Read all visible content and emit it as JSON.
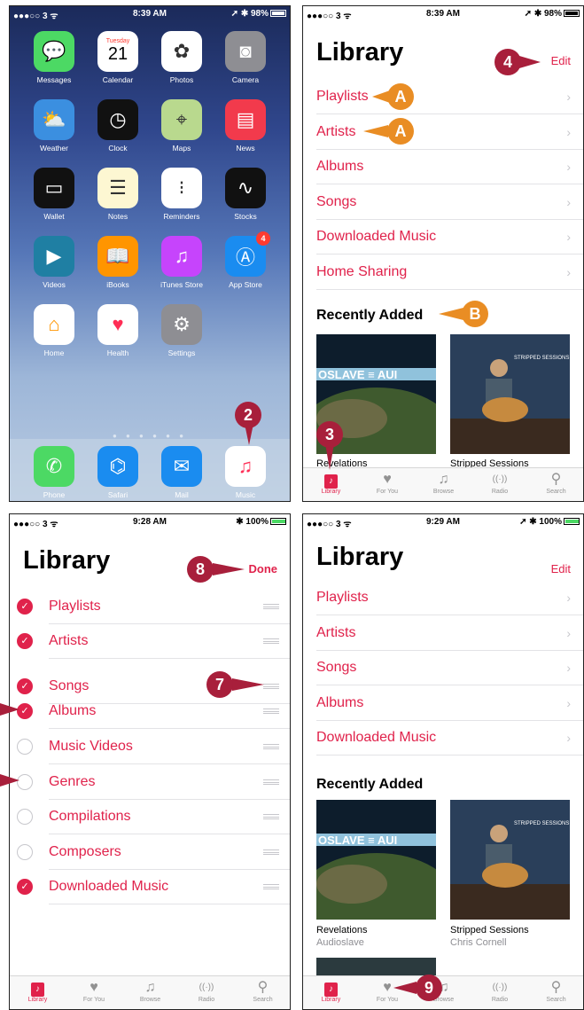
{
  "home": {
    "status": {
      "left": "●●●○○ 3 ᯤ",
      "time": "8:39 AM",
      "right": "➚ ✱ 98%"
    },
    "apps": [
      {
        "label": "Messages",
        "icon": "messages-icon",
        "glyph": "💬",
        "color": "#4cd964"
      },
      {
        "label": "Calendar",
        "icon": "calendar-icon",
        "glyph": "21",
        "color": "#ffffff",
        "sub": "Tuesday"
      },
      {
        "label": "Photos",
        "icon": "photos-icon",
        "glyph": "✿",
        "color": "#ffffff"
      },
      {
        "label": "Camera",
        "icon": "camera-icon",
        "glyph": "◙",
        "color": "#8e8e93"
      },
      {
        "label": "Weather",
        "icon": "weather-icon",
        "glyph": "⛅",
        "color": "#3b8fe0"
      },
      {
        "label": "Clock",
        "icon": "clock-icon",
        "glyph": "◷",
        "color": "#111111"
      },
      {
        "label": "Maps",
        "icon": "maps-icon",
        "glyph": "⌖",
        "color": "#b9d98e"
      },
      {
        "label": "News",
        "icon": "news-icon",
        "glyph": "▤",
        "color": "#f23a4c"
      },
      {
        "label": "Wallet",
        "icon": "wallet-icon",
        "glyph": "▭",
        "color": "#111111"
      },
      {
        "label": "Notes",
        "icon": "notes-icon",
        "glyph": "☰",
        "color": "#fdf7d2"
      },
      {
        "label": "Reminders",
        "icon": "reminders-icon",
        "glyph": "⁝",
        "color": "#ffffff"
      },
      {
        "label": "Stocks",
        "icon": "stocks-icon",
        "glyph": "∿",
        "color": "#111111"
      },
      {
        "label": "Videos",
        "icon": "videos-icon",
        "glyph": "▶",
        "color": "#1f7fa3"
      },
      {
        "label": "iBooks",
        "icon": "ibooks-icon",
        "glyph": "📖",
        "color": "#ff9500"
      },
      {
        "label": "iTunes Store",
        "icon": "itunes-store-icon",
        "glyph": "♫",
        "color": "#c644fc"
      },
      {
        "label": "App Store",
        "icon": "app-store-icon",
        "glyph": "Ⓐ",
        "color": "#1a8cf0",
        "badge": "4"
      },
      {
        "label": "Home",
        "icon": "home-app-icon",
        "glyph": "⌂",
        "color": "#ffffff"
      },
      {
        "label": "Health",
        "icon": "health-icon",
        "glyph": "♥",
        "color": "#ffffff"
      },
      {
        "label": "Settings",
        "icon": "settings-icon",
        "glyph": "⚙",
        "color": "#8e8e93"
      }
    ],
    "dock": [
      {
        "label": "Phone",
        "icon": "phone-icon",
        "glyph": "✆",
        "color": "#4cd964"
      },
      {
        "label": "Safari",
        "icon": "safari-icon",
        "glyph": "⌬",
        "color": "#1a8cf0"
      },
      {
        "label": "Mail",
        "icon": "mail-icon",
        "glyph": "✉",
        "color": "#1a8cf0"
      },
      {
        "label": "Music",
        "icon": "music-icon",
        "glyph": "♫",
        "color": "#ffffff"
      }
    ],
    "callout": "2"
  },
  "library1": {
    "status": {
      "left": "●●●○○ 3 ᯤ",
      "time": "8:39 AM",
      "right": "➚ ✱ 98%"
    },
    "title": "Library",
    "edit": "Edit",
    "rows": [
      "Playlists",
      "Artists",
      "Albums",
      "Songs",
      "Downloaded Music",
      "Home Sharing"
    ],
    "recent": "Recently Added",
    "albums": [
      {
        "title": "Revelations",
        "artist": ""
      },
      {
        "title": "Stripped Sessions",
        "artist": ""
      }
    ],
    "callouts": {
      "edit": "4",
      "a1": "A",
      "a2": "A",
      "b": "B",
      "tab": "3"
    }
  },
  "library_edit": {
    "status": {
      "left": "●●●○○ 3 ᯤ",
      "time": "9:28 AM",
      "right": "✱ 100%"
    },
    "title": "Library",
    "done": "Done",
    "rows": [
      {
        "label": "Playlists",
        "checked": true
      },
      {
        "label": "Artists",
        "checked": true
      },
      {
        "label": "Songs",
        "checked": true
      },
      {
        "label": "Albums",
        "checked": true
      },
      {
        "label": "Music Videos",
        "checked": false
      },
      {
        "label": "Genres",
        "checked": false
      },
      {
        "label": "Compilations",
        "checked": false
      },
      {
        "label": "Composers",
        "checked": false
      },
      {
        "label": "Downloaded Music",
        "checked": true
      }
    ],
    "callouts": {
      "done": "8",
      "grip": "7"
    }
  },
  "library2": {
    "status": {
      "left": "●●●○○ 3 ᯤ",
      "time": "9:29 AM",
      "right": "➚ ✱ 100%"
    },
    "title": "Library",
    "edit": "Edit",
    "rows": [
      "Playlists",
      "Artists",
      "Songs",
      "Albums",
      "Downloaded Music"
    ],
    "recent": "Recently Added",
    "albums": [
      {
        "title": "Revelations",
        "artist": "Audioslave"
      },
      {
        "title": "Stripped Sessions",
        "artist": "Chris Cornell"
      }
    ],
    "callouts": {
      "tab": "9"
    }
  },
  "tabs": [
    {
      "label": "Library",
      "icon": "library-icon",
      "glyph": "♪"
    },
    {
      "label": "For You",
      "icon": "heart-icon",
      "glyph": "♥"
    },
    {
      "label": "Browse",
      "icon": "note-icon",
      "glyph": "♫"
    },
    {
      "label": "Radio",
      "icon": "radio-icon",
      "glyph": "((·))"
    },
    {
      "label": "Search",
      "icon": "search-icon",
      "glyph": "⚲"
    }
  ],
  "colors": {
    "accent": "#e0224b",
    "callout_red": "#a81f3b",
    "callout_orange": "#e98d24"
  }
}
